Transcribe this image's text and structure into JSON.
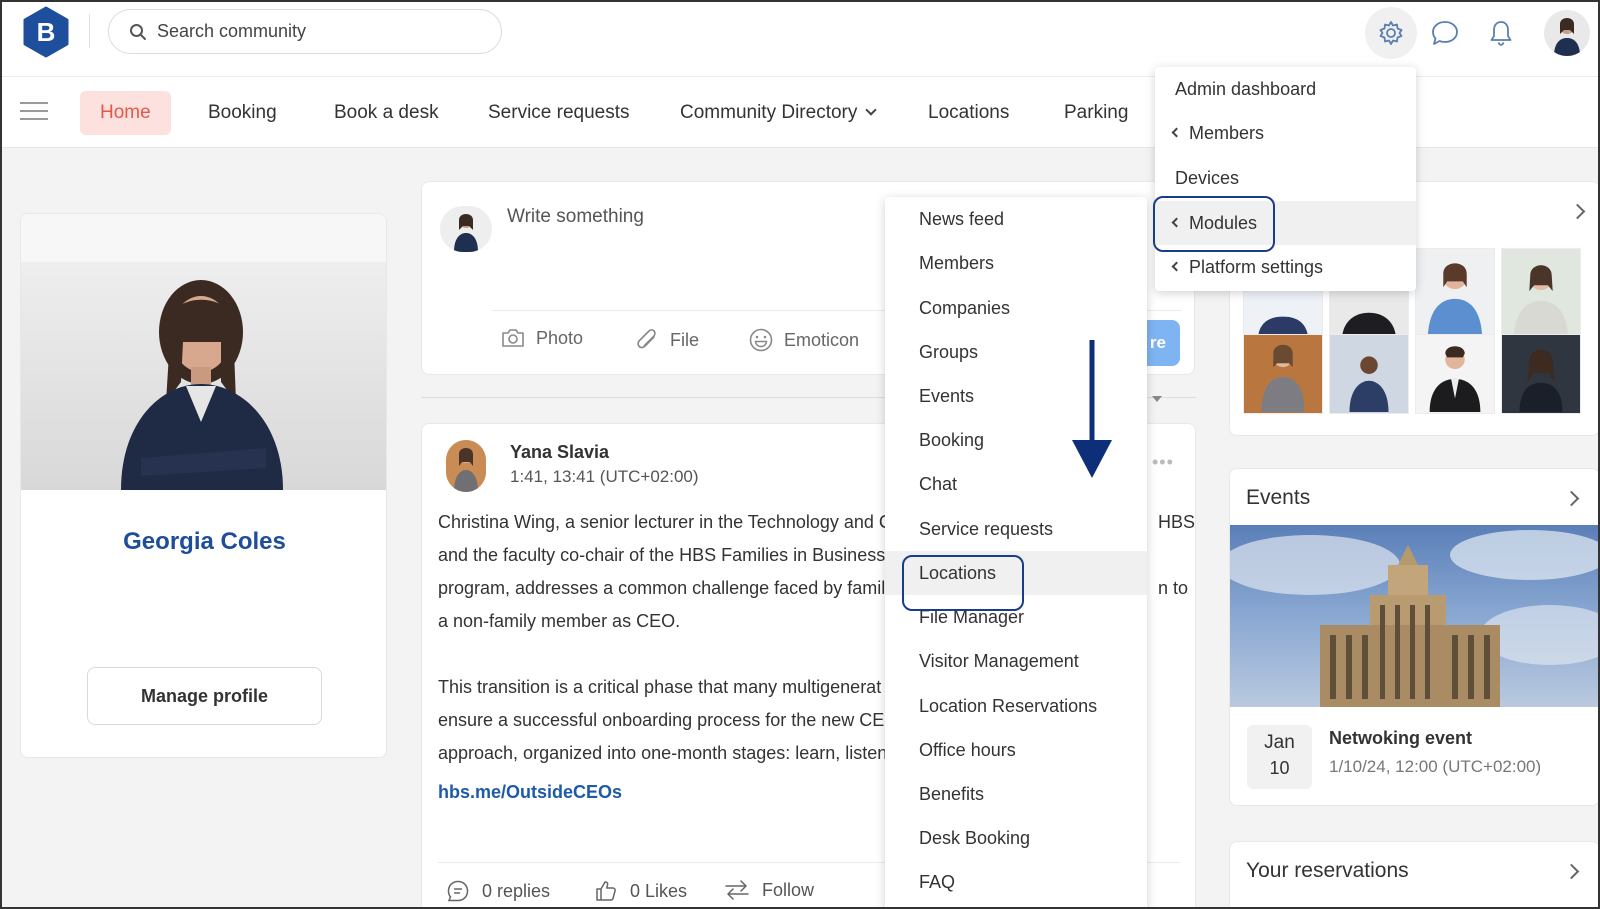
{
  "topbar": {
    "logo_letter": "B",
    "search_placeholder": "Search community"
  },
  "nav": {
    "items": [
      {
        "label": "Home",
        "active": true
      },
      {
        "label": "Booking"
      },
      {
        "label": "Book a desk"
      },
      {
        "label": "Service requests"
      },
      {
        "label": "Community Directory",
        "has_dropdown": true
      },
      {
        "label": "Locations"
      },
      {
        "label": "Parking"
      }
    ]
  },
  "profile": {
    "name": "Georgia Coles",
    "manage_label": "Manage profile"
  },
  "composer": {
    "placeholder": "Write something",
    "actions": {
      "photo": "Photo",
      "file": "File",
      "emoticon": "Emoticon"
    },
    "share_label": "re"
  },
  "post": {
    "author": "Yana Slavia",
    "time": "1:41, 13:41 (UTC+02:00)",
    "paragraph1": [
      "Christina Wing, a senior lecturer in the Technology and C",
      "and the faculty co-chair of the HBS Families in Business:",
      "program, addresses a common challenge faced by family",
      "a non-family member as CEO."
    ],
    "paragraph1_right": [
      "HBS",
      "",
      "n to"
    ],
    "paragraph2": [
      "This transition is a critical phase that many multigenerat",
      "ensure a successful onboarding process for the new CEC",
      "approach, organized into one-month stages: learn, listen"
    ],
    "link": "hbs.me/OutsideCEOs",
    "replies": "0 replies",
    "likes": "0 Likes",
    "follow": "Follow"
  },
  "events": {
    "title": "Events",
    "event_month": "Jan",
    "event_day": "10",
    "event_name": "Netwoking event",
    "event_time": "1/10/24, 12:00 (UTC+02:00)"
  },
  "reservations": {
    "title": "Your reservations"
  },
  "settings_menu": {
    "items": [
      {
        "label": "Admin dashboard",
        "submenu": false
      },
      {
        "label": "Members",
        "submenu": true
      },
      {
        "label": "Devices",
        "submenu": false
      },
      {
        "label": "Modules",
        "submenu": true,
        "highlighted": true
      },
      {
        "label": "Platform settings",
        "submenu": true
      }
    ]
  },
  "modules_menu": {
    "items": [
      "News feed",
      "Members",
      "Companies",
      "Groups",
      "Events",
      "Booking",
      "Chat",
      "Service requests",
      "Locations",
      "File Manager",
      "Visitor Management",
      "Location Reservations",
      "Office hours",
      "Benefits",
      "Desk Booking",
      "FAQ"
    ],
    "highlighted": "Locations"
  },
  "colors": {
    "brand_blue": "#1e4e9a",
    "nav_active_bg": "#fde1de",
    "nav_active_text": "#e4584a",
    "highlight_ring": "#1a3d8a",
    "share_button": "#7fb4f3"
  },
  "icons": {
    "search": "search-icon",
    "gear": "gear-icon",
    "chat": "chat-bubble-icon",
    "bell": "bell-icon",
    "menu": "hamburger-icon",
    "photo": "camera-icon",
    "file": "paperclip-icon",
    "emoticon": "smiley-icon",
    "replies": "comment-icon",
    "likes": "thumbs-up-icon",
    "follow": "swap-arrows-icon",
    "scroll_hint": "down-arrow-icon"
  }
}
